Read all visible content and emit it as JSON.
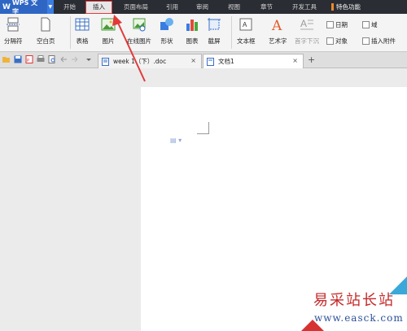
{
  "app": {
    "title": "WPS 文字"
  },
  "menu": [
    "开始",
    "插入",
    "页面布局",
    "引用",
    "审阅",
    "视图",
    "章节",
    "开发工具",
    "特色功能"
  ],
  "ribbon": {
    "page_break": "分隔符",
    "blank_page": "空白页",
    "table": "表格",
    "picture": "图片",
    "online_picture": "在线图片",
    "shape": "形状",
    "chart": "图表",
    "screenshot": "截屏",
    "text_box": "文本框",
    "art_text": "艺术字",
    "drop_cap": "首字下沉",
    "date": "日期",
    "field": "域",
    "object": "对象",
    "attachment": "插入附件"
  },
  "tabs": [
    {
      "label": "week 1（下）.doc",
      "close": "×"
    },
    {
      "label": "文档1",
      "close": "×"
    }
  ],
  "tab_add": "+",
  "watermark": {
    "brand": "易采站长站",
    "url": "www.easck.com"
  },
  "colors": {
    "menubar": "#2a2d33",
    "app_button": "#2f66c4",
    "highlight": "#e23a3a"
  }
}
